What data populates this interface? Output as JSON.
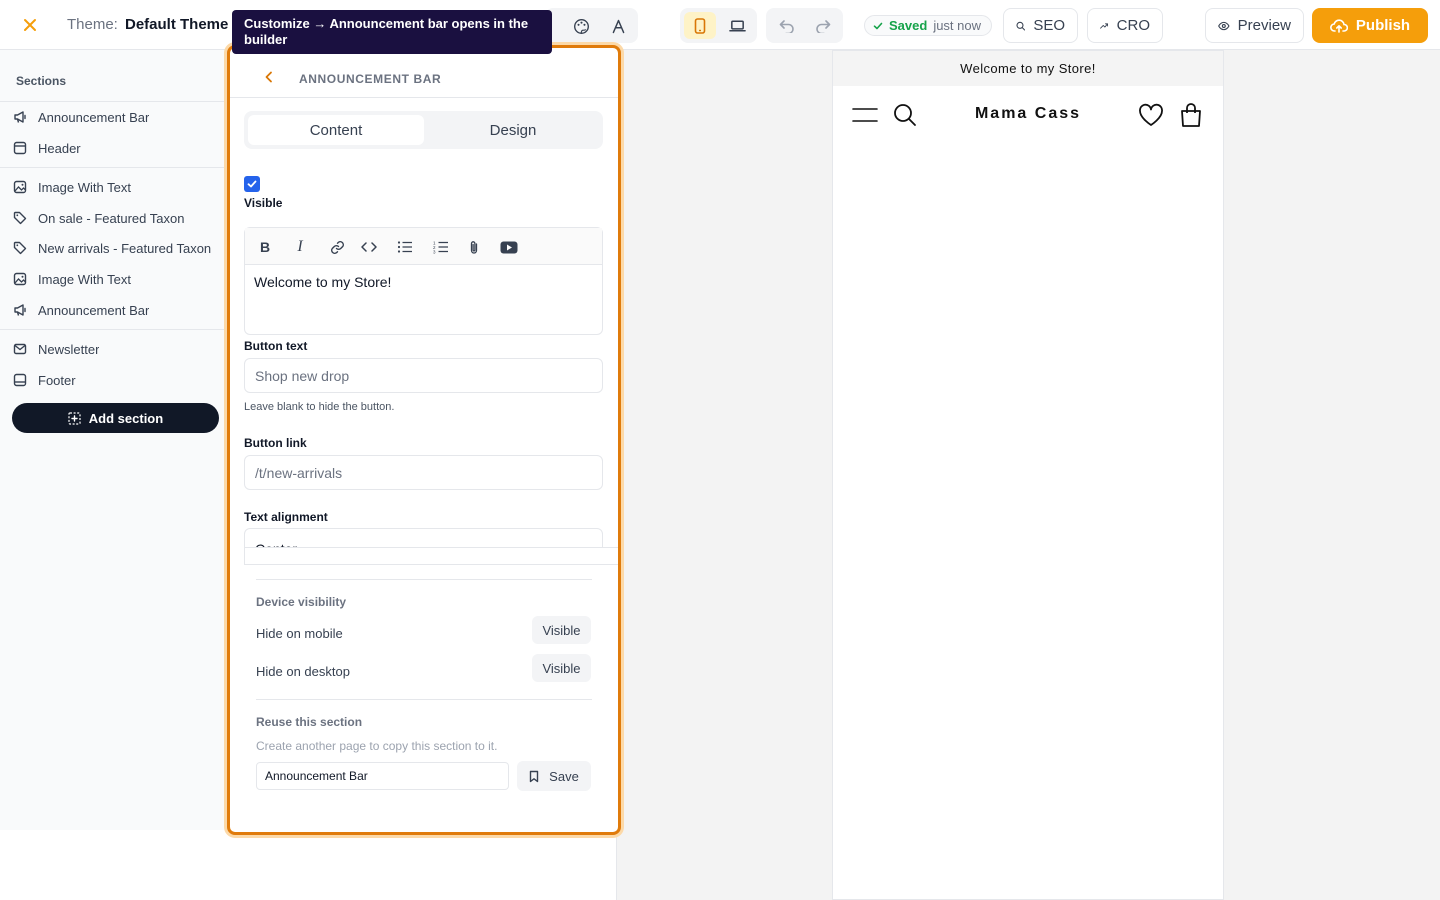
{
  "topbar": {
    "theme_label": "Theme:",
    "theme_name": "Default Theme",
    "saved_status": "Saved",
    "saved_time": "just now",
    "seo_label": "SEO",
    "cro_label": "CRO",
    "preview_label": "Preview",
    "publish_label": "Publish"
  },
  "tooltip": {
    "text": "Customize → Announcement bar opens in the builder"
  },
  "sidebar": {
    "title": "Sections",
    "items": [
      {
        "label": "Announcement Bar",
        "icon": "megaphone-icon"
      },
      {
        "label": "Header",
        "icon": "layout-header-icon"
      },
      {
        "label": "Image With Text",
        "icon": "image-icon"
      },
      {
        "label": "On sale - Featured Taxon",
        "icon": "tag-icon"
      },
      {
        "label": "New arrivals - Featured Taxon",
        "icon": "tag-icon"
      },
      {
        "label": "Image With Text",
        "icon": "image-icon"
      },
      {
        "label": "Announcement Bar",
        "icon": "megaphone-icon"
      },
      {
        "label": "Newsletter",
        "icon": "mail-icon"
      },
      {
        "label": "Footer",
        "icon": "layout-footer-icon"
      }
    ],
    "add_section_label": "Add section"
  },
  "panel": {
    "title": "ANNOUNCEMENT BAR",
    "tabs": [
      {
        "label": "Content",
        "active": true
      },
      {
        "label": "Design",
        "active": false
      }
    ],
    "visible_label": "Visible",
    "visible_checked": true,
    "editor_text": "Welcome to my Store!",
    "button_text_label": "Button text",
    "button_text_placeholder": "Shop new drop",
    "button_text_help": "Leave blank to hide the button.",
    "button_link_label": "Button link",
    "button_link_placeholder": "/t/new-arrivals",
    "text_alignment_label": "Text alignment",
    "text_alignment_value": "Center",
    "device_visibility_title": "Device visibility",
    "hide_on_mobile_label": "Hide on mobile",
    "hide_on_mobile_value": "Visible",
    "hide_on_desktop_label": "Hide on desktop",
    "hide_on_desktop_value": "Visible",
    "reuse_title": "Reuse this section",
    "reuse_help": "Create another page to copy this section to it.",
    "reuse_name_value": "Announcement Bar",
    "save_label": "Save"
  },
  "preview": {
    "announcement": "Welcome to my Store!",
    "store_name": "Mama Cass"
  },
  "colors": {
    "accent": "#f59e0b",
    "panel_outline": "#e07b0b",
    "tooltip_bg": "#1a1040",
    "checkbox": "#2563eb",
    "saved_green": "#16a34a"
  }
}
